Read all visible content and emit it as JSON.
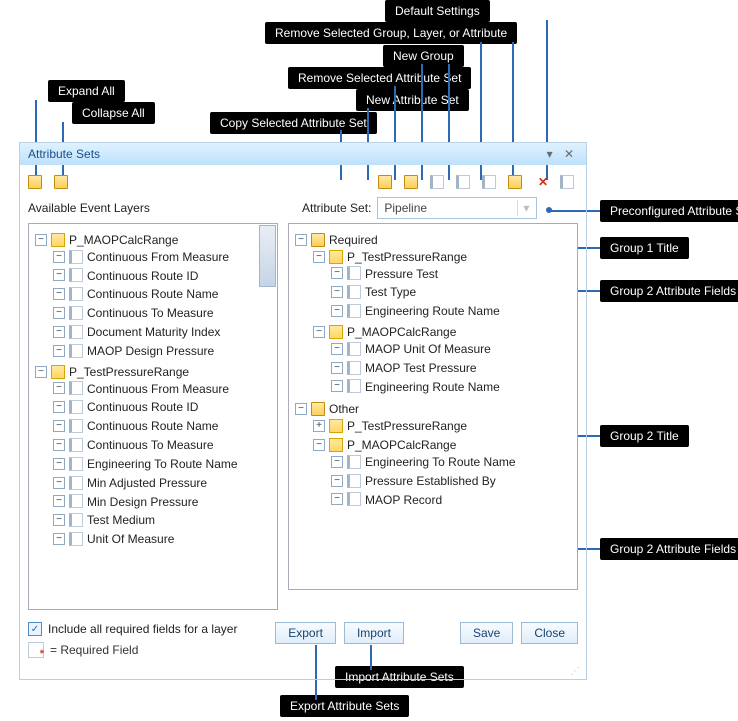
{
  "callouts": {
    "default_settings": "Default Settings",
    "remove_gla": "Remove Selected Group, Layer, or Attribute",
    "new_group": "New Group",
    "remove_set": "Remove Selected Attribute Set",
    "new_set": "New Attribute Set",
    "copy_set": "Copy Selected Attribute Set",
    "expand_all": "Expand All",
    "collapse_all": "Collapse All",
    "preconfigured": "Preconfigured Attribute Sets",
    "group1_title": "Group 1 Title",
    "group2_attr_field": "Group 2 Attribute Fields",
    "group2_title": "Group 2 Title",
    "group2_attr_field_b": "Group 2 Attribute Fields",
    "import_set": "Import Attribute Sets",
    "export_set": "Export Attribute Sets"
  },
  "dialog": {
    "title": "Attribute Sets",
    "available_label": "Available Event Layers",
    "attr_set_label": "Attribute Set:",
    "attr_set_value": "Pipeline",
    "include_chk": "Include all required fields for a layer",
    "legend_text": "= Required Field",
    "buttons": {
      "export": "Export",
      "import": "Import",
      "save": "Save",
      "close": "Close"
    }
  },
  "left_tree": [
    {
      "label": "P_MAOPCalcRange",
      "type": "layer",
      "children": [
        {
          "label": "Continuous From Measure"
        },
        {
          "label": "Continuous Route ID"
        },
        {
          "label": "Continuous Route Name"
        },
        {
          "label": "Continuous To Measure"
        },
        {
          "label": "Document Maturity Index"
        },
        {
          "label": "MAOP Design Pressure"
        }
      ]
    },
    {
      "label": "P_TestPressureRange",
      "type": "layer",
      "children": [
        {
          "label": "Continuous From Measure"
        },
        {
          "label": "Continuous Route ID"
        },
        {
          "label": "Continuous Route Name"
        },
        {
          "label": "Continuous To Measure"
        },
        {
          "label": "Engineering To Route Name"
        },
        {
          "label": "Min Adjusted Pressure"
        },
        {
          "label": "Min Design Pressure"
        },
        {
          "label": "Test Medium"
        },
        {
          "label": "Unit Of Measure"
        }
      ]
    }
  ],
  "right_tree": [
    {
      "label": "Required",
      "type": "folder",
      "children": [
        {
          "label": "P_TestPressureRange",
          "type": "layer",
          "children": [
            {
              "label": "Pressure Test"
            },
            {
              "label": "Test Type"
            },
            {
              "label": "Engineering Route Name"
            }
          ]
        },
        {
          "label": "P_MAOPCalcRange",
          "type": "layer",
          "children": [
            {
              "label": "MAOP Unit Of Measure"
            },
            {
              "label": "MAOP Test Pressure"
            },
            {
              "label": "Engineering Route Name"
            }
          ]
        }
      ]
    },
    {
      "label": "Other",
      "type": "folder",
      "children": [
        {
          "label": "P_TestPressureRange",
          "type": "layer",
          "collapsed": true
        },
        {
          "label": "P_MAOPCalcRange",
          "type": "layer",
          "children": [
            {
              "label": "Engineering To Route Name"
            },
            {
              "label": "Pressure Established By"
            },
            {
              "label": "MAOP Record"
            }
          ]
        }
      ]
    }
  ]
}
